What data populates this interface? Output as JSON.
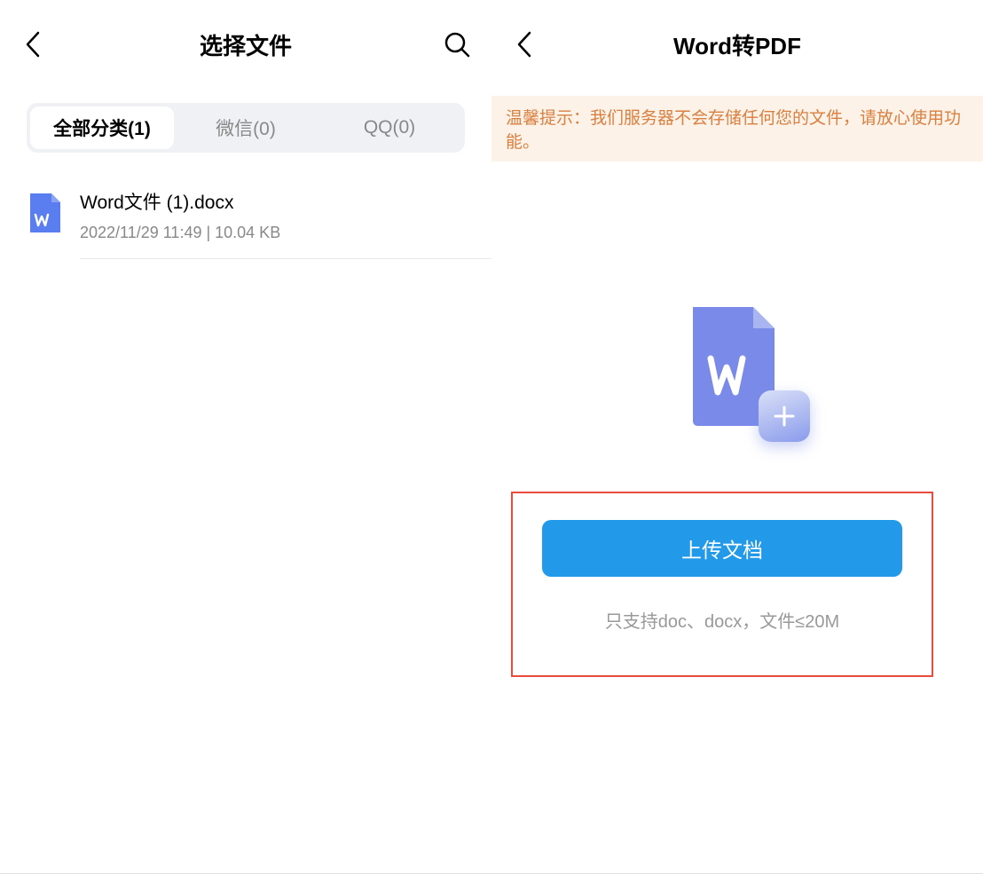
{
  "left": {
    "title": "选择文件",
    "tabs": [
      {
        "label": "全部分类(1)",
        "active": true
      },
      {
        "label": "微信(0)",
        "active": false
      },
      {
        "label": "QQ(0)",
        "active": false
      }
    ],
    "files": [
      {
        "name": "Word文件 (1).docx",
        "meta": "2022/11/29 11:49 |  10.04 KB"
      }
    ]
  },
  "right": {
    "title": "Word转PDF",
    "notice": "温馨提示：我们服务器不会存储任何您的文件，请放心使用功能。",
    "upload_button": "上传文档",
    "upload_hint": "只支持doc、docx，文件≤20M"
  }
}
